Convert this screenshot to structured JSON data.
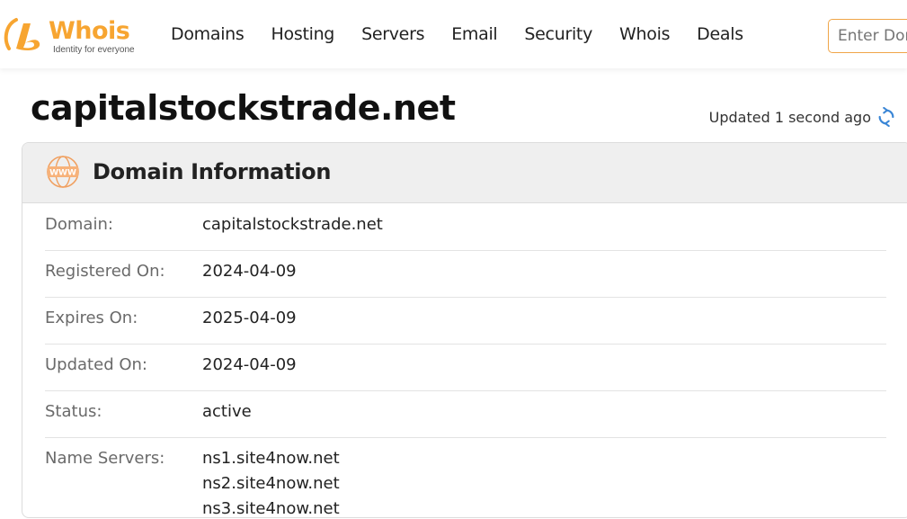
{
  "brand": {
    "name": "Whois",
    "tagline": "Identity for everyone",
    "accent": "#f7a531"
  },
  "nav": {
    "items": [
      "Domains",
      "Hosting",
      "Servers",
      "Email",
      "Security",
      "Whois",
      "Deals"
    ]
  },
  "search": {
    "placeholder": "Enter Domain or IP"
  },
  "page": {
    "title": "capitalstockstrade.net",
    "updated": "Updated 1 second ago"
  },
  "panel": {
    "title": "Domain Information",
    "rows": [
      {
        "label": "Domain:",
        "value": "capitalstockstrade.net"
      },
      {
        "label": "Registered On:",
        "value": "2024-04-09"
      },
      {
        "label": "Expires On:",
        "value": "2025-04-09"
      },
      {
        "label": "Updated On:",
        "value": "2024-04-09"
      },
      {
        "label": "Status:",
        "value": "active"
      },
      {
        "label": "Name Servers:",
        "values": [
          "ns1.site4now.net",
          "ns2.site4now.net",
          "ns3.site4now.net"
        ]
      }
    ]
  },
  "icons": {
    "logo": "whois-logo-icon",
    "refresh": "refresh-icon",
    "section": "www-icon"
  }
}
